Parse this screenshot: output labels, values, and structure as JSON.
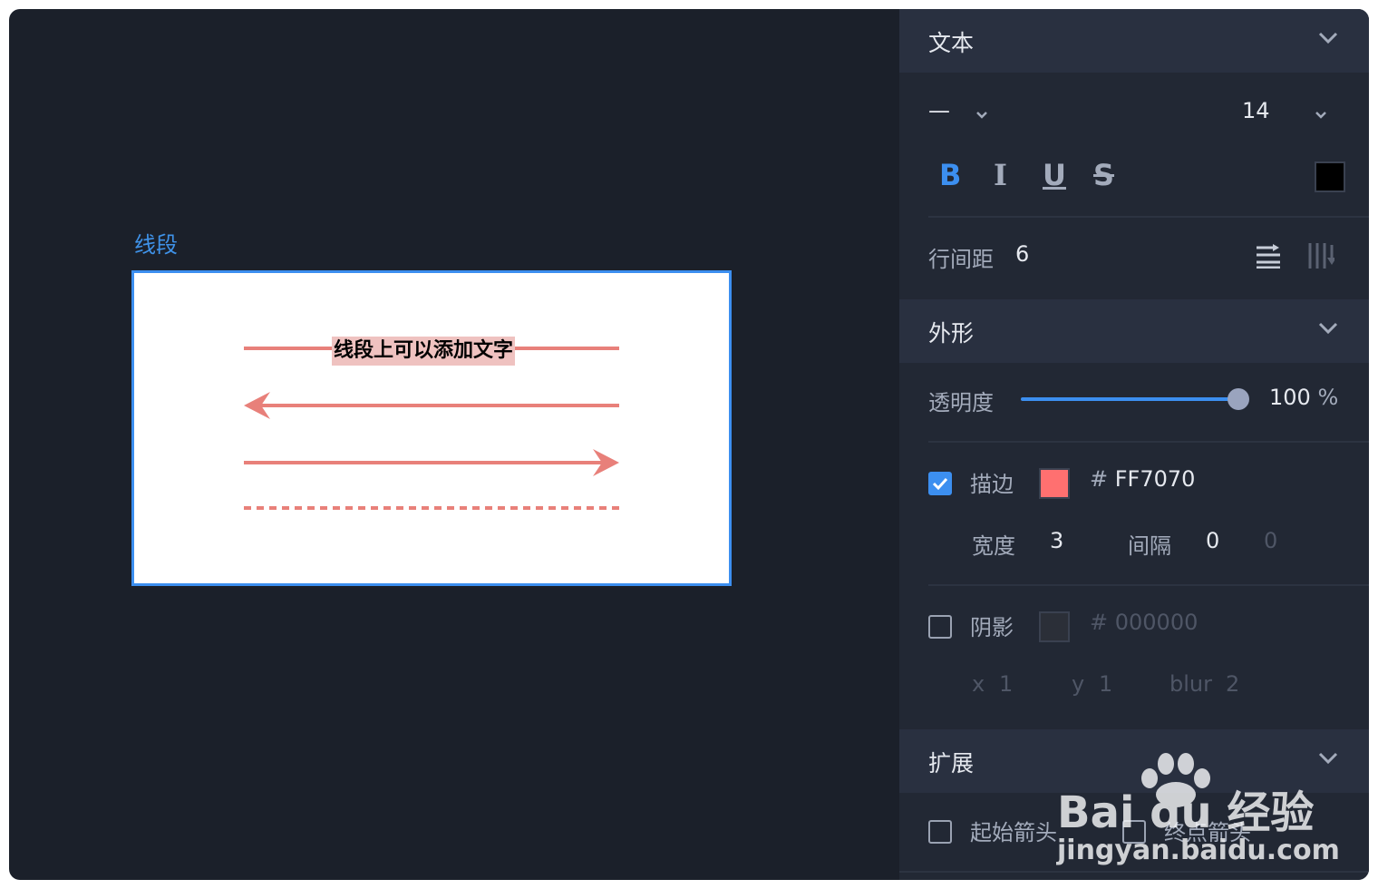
{
  "canvas": {
    "shape_label": "线段",
    "line_text": "线段上可以添加文字",
    "line_color": "#e8807a"
  },
  "text_section": {
    "title": "文本",
    "font_family_value": "—",
    "font_size_value": "14",
    "bold_label": "B",
    "italic_label": "I",
    "underline_label": "U",
    "strike_label": "S",
    "color": "#000000",
    "line_height_label": "行间距",
    "line_height_value": "6"
  },
  "appearance_section": {
    "title": "外形",
    "opacity_label": "透明度",
    "opacity_value": "100",
    "opacity_unit": "%",
    "opacity_fraction": 1.0,
    "stroke": {
      "checked": true,
      "label": "描边",
      "color": "#FF7070",
      "hex_prefix": "#",
      "hex_value": "FF7070",
      "width_label": "宽度",
      "width_value": "3",
      "gap_label": "间隔",
      "gap_value_1": "0",
      "gap_value_2": "0"
    },
    "shadow": {
      "checked": false,
      "label": "阴影",
      "hex_prefix": "#",
      "hex_value": "000000",
      "x_label": "x",
      "x_value": "1",
      "y_label": "y",
      "y_value": "1",
      "blur_label": "blur",
      "blur_value": "2"
    }
  },
  "extend_section": {
    "title": "扩展",
    "start_arrow_label": "起始箭头",
    "end_arrow_label": "终点箭头"
  },
  "watermark": {
    "brand_text": "Bai du 经验",
    "url_text": "jingyan.baidu.com"
  }
}
